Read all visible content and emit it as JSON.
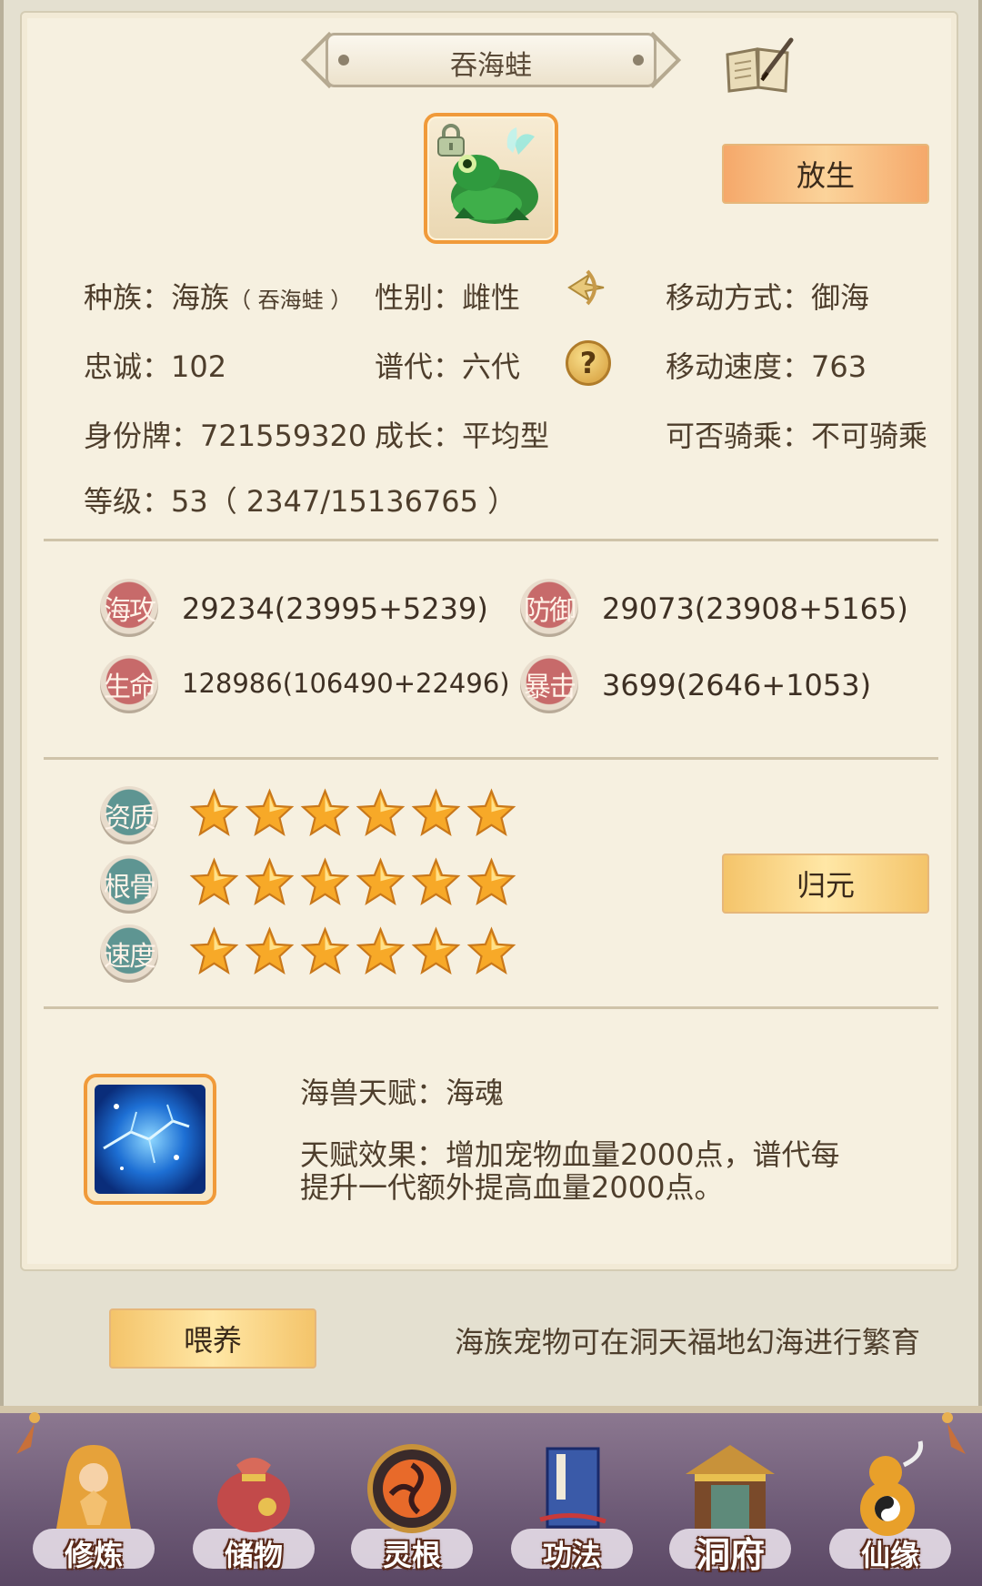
{
  "header": {
    "title": "吞海蛙"
  },
  "actions": {
    "release_label": "放生",
    "return_label": "归元",
    "feed_label": "喂养"
  },
  "info": {
    "race_label": "种族：",
    "race_value": "海族",
    "race_sub": "（ 吞海蛙 ）",
    "gender_label": "性别：",
    "gender_value": "雌性",
    "move_mode_label": "移动方式：",
    "move_mode_value": "御海",
    "loyalty_label": "忠诚：",
    "loyalty_value": "102",
    "generation_label": "谱代：",
    "generation_value": "六代",
    "move_speed_label": "移动速度：",
    "move_speed_value": "763",
    "id_label": "身份牌：",
    "id_value": "721559320",
    "growth_label": "成长：",
    "growth_value": "平均型",
    "ride_label": "可否骑乘：",
    "ride_value": "不可骑乘",
    "level_label": "等级：",
    "level_value": "53",
    "level_exp": "（ 2347/15136765 ）"
  },
  "stats": [
    {
      "name": "海攻",
      "value": "29234(23995+5239)"
    },
    {
      "name": "防御",
      "value": "29073(23908+5165)"
    },
    {
      "name": "生命",
      "value": "128986(106490+22496)"
    },
    {
      "name": "暴击",
      "value": "3699(2646+1053)"
    }
  ],
  "aptitudes": [
    {
      "name": "资质",
      "stars": 6
    },
    {
      "name": "根骨",
      "stars": 6
    },
    {
      "name": "速度",
      "stars": 6
    }
  ],
  "talent": {
    "name_label": "海兽天赋：",
    "name_value": "海魂",
    "effect_line1": "天赋效果：增加宠物血量2000点，谱代每",
    "effect_line2": "提升一代额外提高血量2000点。"
  },
  "feed_note": "海族宠物可在洞天福地幻海进行繁育",
  "nav": [
    {
      "label": "修炼",
      "icon": "monk-icon"
    },
    {
      "label": "储物",
      "icon": "bag-icon"
    },
    {
      "label": "灵根",
      "icon": "spiral-icon"
    },
    {
      "label": "功法",
      "icon": "scroll-book-icon"
    },
    {
      "label": "洞府",
      "icon": "palace-icon"
    },
    {
      "label": "仙缘",
      "icon": "gourd-icon"
    }
  ],
  "colors": {
    "accent_orange": "#f09a3a",
    "badge_red": "#c76a6a",
    "badge_teal": "#5e9592",
    "star": "#f7a928"
  }
}
